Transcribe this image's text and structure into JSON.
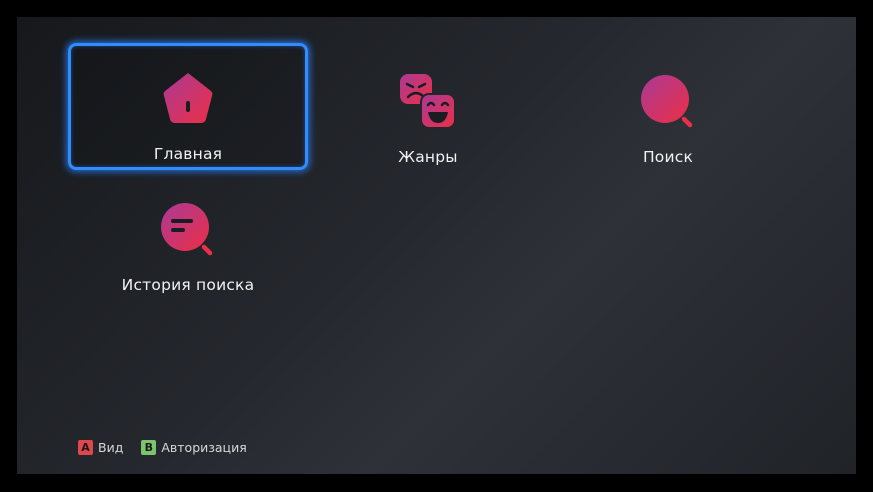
{
  "menu": {
    "items": [
      {
        "label": "Главная",
        "icon": "home-icon",
        "focused": true
      },
      {
        "label": "Жанры",
        "icon": "genres-masks-icon",
        "focused": false
      },
      {
        "label": "Поиск",
        "icon": "search-icon",
        "focused": false
      },
      {
        "label": "История поиска",
        "icon": "search-history-icon",
        "focused": false
      }
    ]
  },
  "hints": {
    "a": {
      "key": "A",
      "label": "Вид",
      "color": "#e0474c"
    },
    "b": {
      "key": "B",
      "label": "Авторизация",
      "color": "#7cc36e"
    }
  },
  "colors": {
    "focus_border": "#2f8dff",
    "icon_gradient_start": "#b0378f",
    "icon_gradient_end": "#e8304a"
  }
}
